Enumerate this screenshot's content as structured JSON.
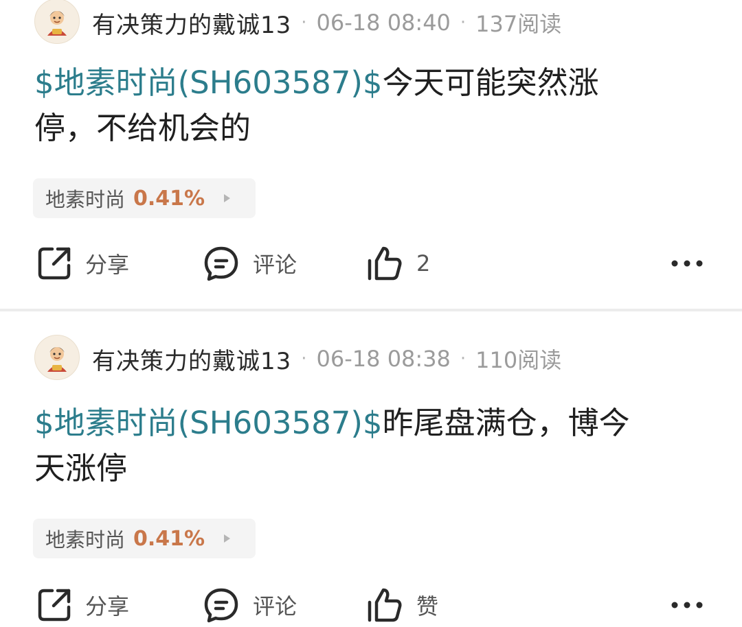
{
  "posts": [
    {
      "author": "有决策力的戴诚13",
      "time": "06-18 08:40",
      "views": "137阅读",
      "stock_tag": "$地素时尚(SH603587)$",
      "text_line1": "今天可能突然涨",
      "text_line2": "停，不给机会的",
      "stock": {
        "name": "地素时尚",
        "change": "0.41%"
      },
      "actions": {
        "share": "分享",
        "comment": "评论",
        "like": "2"
      }
    },
    {
      "author": "有决策力的戴诚13",
      "time": "06-18 08:38",
      "views": "110阅读",
      "stock_tag": "$地素时尚(SH603587)$",
      "text_line1": "昨尾盘满仓，博今",
      "text_line2": "天涨停",
      "stock": {
        "name": "地素时尚",
        "change": "0.41%"
      },
      "actions": {
        "share": "分享",
        "comment": "评论",
        "like": "赞"
      }
    }
  ],
  "separator": "·",
  "icons": {
    "avatar": "avatar-icon",
    "share": "share-icon",
    "comment": "comment-icon",
    "like": "thumbs-up-icon",
    "more": "more-dots-icon",
    "chip_arrow": "chevron-right-icon"
  },
  "colors": {
    "stock_tag": "#2c7d8c",
    "stock_change": "#c9774a",
    "chip_bg": "#f4f4f4",
    "divider": "#ececec"
  }
}
